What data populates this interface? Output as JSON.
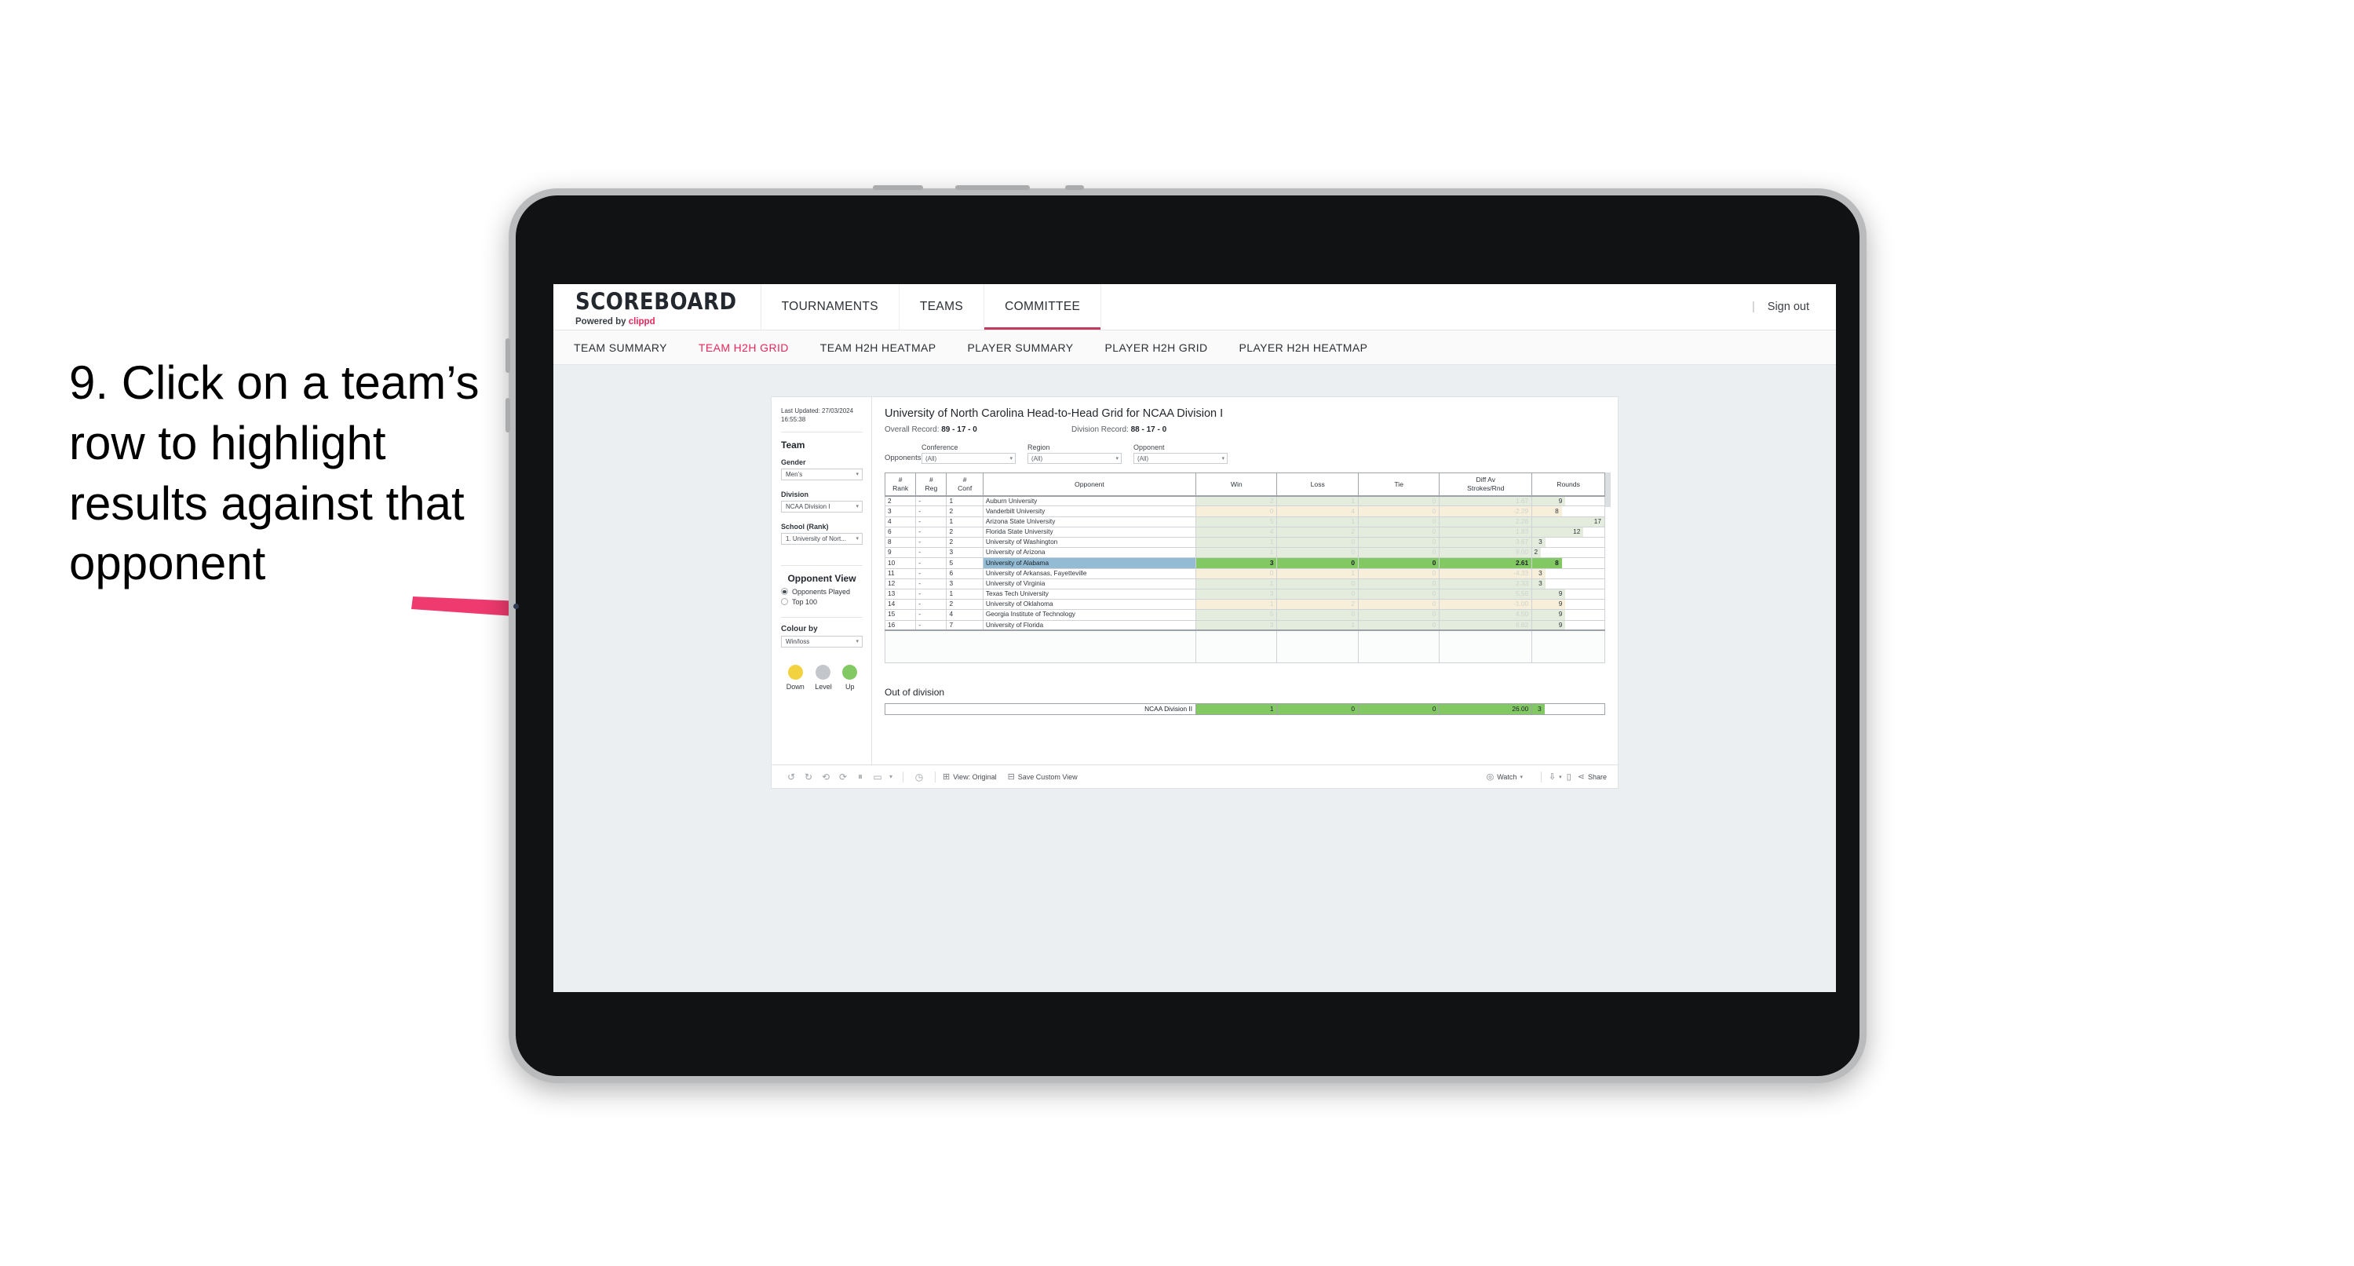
{
  "annotation": {
    "text": "9. Click on a team’s row to highlight results against that opponent",
    "arrow_color": "#ee3a6e"
  },
  "app": {
    "brand": {
      "title": "SCOREBOARD",
      "powered_prefix": "Powered by ",
      "powered_name": "clippd"
    },
    "top_tabs": [
      {
        "label": "TOURNAMENTS",
        "active": false
      },
      {
        "label": "TEAMS",
        "active": false
      },
      {
        "label": "COMMITTEE",
        "active": true
      }
    ],
    "sign_out": "Sign out",
    "sign_out_divider": "|",
    "sub_tabs": [
      {
        "label": "TEAM SUMMARY",
        "active": false
      },
      {
        "label": "TEAM H2H GRID",
        "active": true
      },
      {
        "label": "TEAM H2H HEATMAP",
        "active": false
      },
      {
        "label": "PLAYER SUMMARY",
        "active": false
      },
      {
        "label": "PLAYER H2H GRID",
        "active": false
      },
      {
        "label": "PLAYER H2H HEATMAP",
        "active": false
      }
    ]
  },
  "sidebar": {
    "last_updated_line1": "Last Updated: 27/03/2024",
    "last_updated_line2": "16:55:38",
    "team_heading": "Team",
    "gender_label": "Gender",
    "gender_value": "Men’s",
    "division_label": "Division",
    "division_value": "NCAA Division I",
    "school_label": "School (Rank)",
    "school_value": "1. University of Nort...",
    "opponent_view_heading": "Opponent View",
    "opponent_view_options": [
      {
        "label": "Opponents Played",
        "selected": true
      },
      {
        "label": "Top 100",
        "selected": false
      }
    ],
    "colour_by_label": "Colour by",
    "colour_by_value": "Win/loss",
    "legend": [
      {
        "label": "Down",
        "color": "#f2d23f"
      },
      {
        "label": "Level",
        "color": "#c3c7cb"
      },
      {
        "label": "Up",
        "color": "#82c964"
      }
    ]
  },
  "main": {
    "title": "University of North Carolina Head-to-Head Grid for NCAA Division I",
    "overall_record_label": "Overall Record: ",
    "overall_record_value": "89 - 17 - 0",
    "division_record_label": "Division Record: ",
    "division_record_value": "88 - 17 - 0",
    "filters_label": "Opponents:",
    "filters": [
      {
        "label": "Conference",
        "value": "(All)"
      },
      {
        "label": "Region",
        "value": "(All)"
      },
      {
        "label": "Opponent",
        "value": "(All)"
      }
    ],
    "out_of_division_title": "Out of division",
    "out_of_division_row": {
      "label": "NCAA Division II",
      "win": "1",
      "loss": "0",
      "tie": "0",
      "diff": "26.00",
      "rounds": "3",
      "rounds_pct": 17
    }
  },
  "chart_data": {
    "type": "table",
    "title": "University of North Carolina Head-to-Head Grid for NCAA Division I",
    "columns": [
      "# Rank",
      "# Reg",
      "# Conf",
      "Opponent",
      "Win",
      "Loss",
      "Tie",
      "Diff Av Strokes/Rnd",
      "Rounds"
    ],
    "column_headers_multiline": [
      [
        "#",
        "Rank"
      ],
      [
        "#",
        "Reg"
      ],
      [
        "#",
        "Conf"
      ],
      [
        "Opponent"
      ],
      [
        "Win"
      ],
      [
        "Loss"
      ],
      [
        "Tie"
      ],
      [
        "Diff Av",
        "Strokes/Rnd"
      ],
      [
        "Rounds"
      ]
    ],
    "rows": [
      {
        "rank": "2",
        "reg": "-",
        "conf": "1",
        "opponent": "Auburn University",
        "win": "2",
        "loss": "1",
        "tie": "0",
        "diff": "1.67",
        "rounds": "9",
        "rounds_pct": 46,
        "tone": "up",
        "selected": false
      },
      {
        "rank": "3",
        "reg": "-",
        "conf": "2",
        "opponent": "Vanderbilt University",
        "win": "0",
        "loss": "4",
        "tie": "0",
        "diff": "-2.29",
        "rounds": "8",
        "rounds_pct": 41,
        "tone": "down",
        "selected": false
      },
      {
        "rank": "4",
        "reg": "-",
        "conf": "1",
        "opponent": "Arizona State University",
        "win": "5",
        "loss": "1",
        "tie": "0",
        "diff": "2.28",
        "rounds": "17",
        "rounds_pct": 100,
        "tone": "up",
        "selected": false
      },
      {
        "rank": "6",
        "reg": "-",
        "conf": "2",
        "opponent": "Florida State University",
        "win": "4",
        "loss": "2",
        "tie": "0",
        "diff": "1.83",
        "rounds": "12",
        "rounds_pct": 71,
        "tone": "up",
        "selected": false
      },
      {
        "rank": "8",
        "reg": "-",
        "conf": "2",
        "opponent": "University of Washington",
        "win": "1",
        "loss": "0",
        "tie": "0",
        "diff": "3.67",
        "rounds": "3",
        "rounds_pct": 18,
        "tone": "up",
        "selected": false
      },
      {
        "rank": "9",
        "reg": "-",
        "conf": "3",
        "opponent": "University of Arizona",
        "win": "1",
        "loss": "0",
        "tie": "0",
        "diff": "9.00",
        "rounds": "2",
        "rounds_pct": 12,
        "tone": "up",
        "selected": false
      },
      {
        "rank": "10",
        "reg": "-",
        "conf": "5",
        "opponent": "University of Alabama",
        "win": "3",
        "loss": "0",
        "tie": "0",
        "diff": "2.61",
        "rounds": "8",
        "rounds_pct": 41,
        "tone": "up",
        "selected": true
      },
      {
        "rank": "11",
        "reg": "-",
        "conf": "6",
        "opponent": "University of Arkansas, Fayetteville",
        "win": "0",
        "loss": "1",
        "tie": "0",
        "diff": "-4.33",
        "rounds": "3",
        "rounds_pct": 18,
        "tone": "down",
        "selected": false
      },
      {
        "rank": "12",
        "reg": "-",
        "conf": "3",
        "opponent": "University of Virginia",
        "win": "1",
        "loss": "0",
        "tie": "0",
        "diff": "2.33",
        "rounds": "3",
        "rounds_pct": 18,
        "tone": "up",
        "selected": false
      },
      {
        "rank": "13",
        "reg": "-",
        "conf": "1",
        "opponent": "Texas Tech University",
        "win": "3",
        "loss": "0",
        "tie": "0",
        "diff": "5.56",
        "rounds": "9",
        "rounds_pct": 46,
        "tone": "up",
        "selected": false
      },
      {
        "rank": "14",
        "reg": "-",
        "conf": "2",
        "opponent": "University of Oklahoma",
        "win": "1",
        "loss": "2",
        "tie": "0",
        "diff": "-1.00",
        "rounds": "9",
        "rounds_pct": 46,
        "tone": "down",
        "selected": false
      },
      {
        "rank": "15",
        "reg": "-",
        "conf": "4",
        "opponent": "Georgia Institute of Technology",
        "win": "5",
        "loss": "0",
        "tie": "0",
        "diff": "4.50",
        "rounds": "9",
        "rounds_pct": 46,
        "tone": "up",
        "selected": false
      },
      {
        "rank": "16",
        "reg": "-",
        "conf": "7",
        "opponent": "University of Florida",
        "win": "3",
        "loss": "1",
        "tie": "0",
        "diff": "6.62",
        "rounds": "9",
        "rounds_pct": 46,
        "tone": "up",
        "selected": false
      }
    ],
    "colors": {
      "up": "#e3ecdd",
      "down": "#f7efd9",
      "selected_fill": "#82c964",
      "selected_opponent": "#93bcd4"
    }
  },
  "toolbar": {
    "view_label": "View: Original",
    "save_label": "Save Custom View",
    "watch_label": "Watch",
    "share_label": "Share"
  }
}
